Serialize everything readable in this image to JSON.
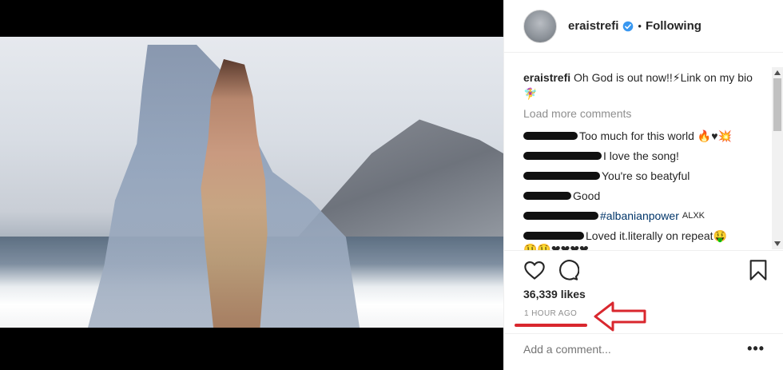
{
  "post": {
    "username": "eraistrefi",
    "following_label": "Following",
    "caption_user": "eraistrefi",
    "caption_text": "Oh God is out now!!⚡Link on my bio 🧚‍♀️",
    "load_more": "Load more comments",
    "comments": [
      {
        "text": "Too much for this world 🔥♥💥"
      },
      {
        "text": "I love the song!"
      },
      {
        "text": "You're so beatyful"
      },
      {
        "text": " Good"
      },
      {
        "hashtag": "#albanianpower",
        "extra": "ALXK"
      },
      {
        "text": "Loved it.literally on repeat🤑",
        "next_line": "🤑🤑❤❤❤❤"
      }
    ],
    "likes": "36,339 likes",
    "time": "1 HOUR AGO",
    "add_comment_placeholder": "Add a comment...",
    "more_label": "•••"
  },
  "colors": {
    "annotation": "#d9272e",
    "verified": "#3897f0",
    "hashtag": "#003569"
  },
  "icons": [
    "heart-icon",
    "comment-icon",
    "bookmark-icon",
    "verified-badge-icon",
    "red-arrow-annotation"
  ]
}
